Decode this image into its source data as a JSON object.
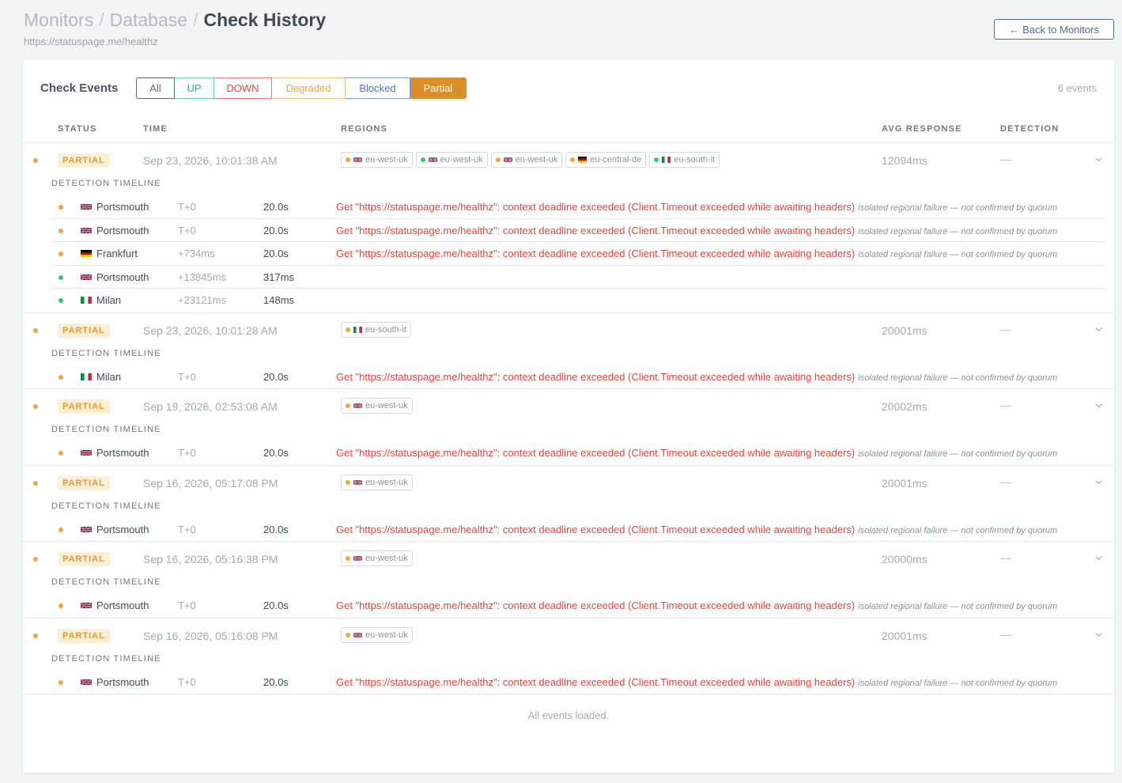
{
  "header": {
    "crumbs": [
      "Monitors",
      "Database"
    ],
    "separator": "/",
    "current": "Check History",
    "subtitle": "https://statuspage.me/healthz"
  },
  "back_button": {
    "arrow": "←",
    "label": "Back to Monitors"
  },
  "card": {
    "title": "Check Events",
    "filters": [
      "All",
      "UP",
      "DOWN",
      "Degraded",
      "Blocked",
      "Partial"
    ],
    "active_filter": "Partial",
    "count": "6 events",
    "columns": [
      "STATUS",
      "TIME",
      "REGIONS",
      "AVG RESPONSE",
      "DETECTION"
    ]
  },
  "detection_label": "DETECTION TIMELINE",
  "error_message": "Get \"https://statuspage.me/healthz\": context deadline exceeded (Client.Timeout exceeded while awaiting headers)",
  "error_note": "isolated regional failure — not confirmed by quorum",
  "events": [
    {
      "status": "PARTIAL",
      "time": "Sep 23, 2026, 10:01:38 AM",
      "avg": "12094ms",
      "detection": "—",
      "regions": [
        {
          "color": "orange",
          "flag": "uk",
          "name": "eu-west-uk"
        },
        {
          "color": "green",
          "flag": "uk",
          "name": "eu-west-uk"
        },
        {
          "color": "orange",
          "flag": "uk",
          "name": "eu-west-uk"
        },
        {
          "color": "orange",
          "flag": "de",
          "name": "eu-central-de"
        },
        {
          "color": "green",
          "flag": "it",
          "name": "eu-south-it"
        }
      ],
      "timeline": [
        {
          "color": "orange",
          "flag": "uk",
          "city": "Portsmouth",
          "offset": "T+0",
          "duration": "20.0s",
          "error": true
        },
        {
          "color": "orange",
          "flag": "uk",
          "city": "Portsmouth",
          "offset": "T+0",
          "duration": "20.0s",
          "error": true
        },
        {
          "color": "orange",
          "flag": "de",
          "city": "Frankfurt",
          "offset": "+734ms",
          "duration": "20.0s",
          "error": true
        },
        {
          "color": "green",
          "flag": "uk",
          "city": "Portsmouth",
          "offset": "+13845ms",
          "duration": "317ms",
          "error": false
        },
        {
          "color": "green",
          "flag": "it",
          "city": "Milan",
          "offset": "+23121ms",
          "duration": "148ms",
          "error": false
        }
      ]
    },
    {
      "status": "PARTIAL",
      "time": "Sep 23, 2026, 10:01:28 AM",
      "avg": "20001ms",
      "detection": "—",
      "regions": [
        {
          "color": "orange",
          "flag": "it",
          "name": "eu-south-it"
        }
      ],
      "timeline": [
        {
          "color": "orange",
          "flag": "it",
          "city": "Milan",
          "offset": "T+0",
          "duration": "20.0s",
          "error": true
        }
      ]
    },
    {
      "status": "PARTIAL",
      "time": "Sep 19, 2026, 02:53:08 AM",
      "avg": "20002ms",
      "detection": "—",
      "regions": [
        {
          "color": "orange",
          "flag": "uk",
          "name": "eu-west-uk"
        }
      ],
      "timeline": [
        {
          "color": "orange",
          "flag": "uk",
          "city": "Portsmouth",
          "offset": "T+0",
          "duration": "20.0s",
          "error": true
        }
      ]
    },
    {
      "status": "PARTIAL",
      "time": "Sep 16, 2026, 05:17:08 PM",
      "avg": "20001ms",
      "detection": "—",
      "regions": [
        {
          "color": "orange",
          "flag": "uk",
          "name": "eu-west-uk"
        }
      ],
      "timeline": [
        {
          "color": "orange",
          "flag": "uk",
          "city": "Portsmouth",
          "offset": "T+0",
          "duration": "20.0s",
          "error": true
        }
      ]
    },
    {
      "status": "PARTIAL",
      "time": "Sep 16, 2026, 05:16:38 PM",
      "avg": "20000ms",
      "detection": "—",
      "regions": [
        {
          "color": "orange",
          "flag": "uk",
          "name": "eu-west-uk"
        }
      ],
      "timeline": [
        {
          "color": "orange",
          "flag": "uk",
          "city": "Portsmouth",
          "offset": "T+0",
          "duration": "20.0s",
          "error": true
        }
      ]
    },
    {
      "status": "PARTIAL",
      "time": "Sep 16, 2026, 05:16:08 PM",
      "avg": "20001ms",
      "detection": "—",
      "regions": [
        {
          "color": "orange",
          "flag": "uk",
          "name": "eu-west-uk"
        }
      ],
      "timeline": [
        {
          "color": "orange",
          "flag": "uk",
          "city": "Portsmouth",
          "offset": "T+0",
          "duration": "20.0s",
          "error": true
        }
      ]
    }
  ],
  "footer": "All events loaded."
}
